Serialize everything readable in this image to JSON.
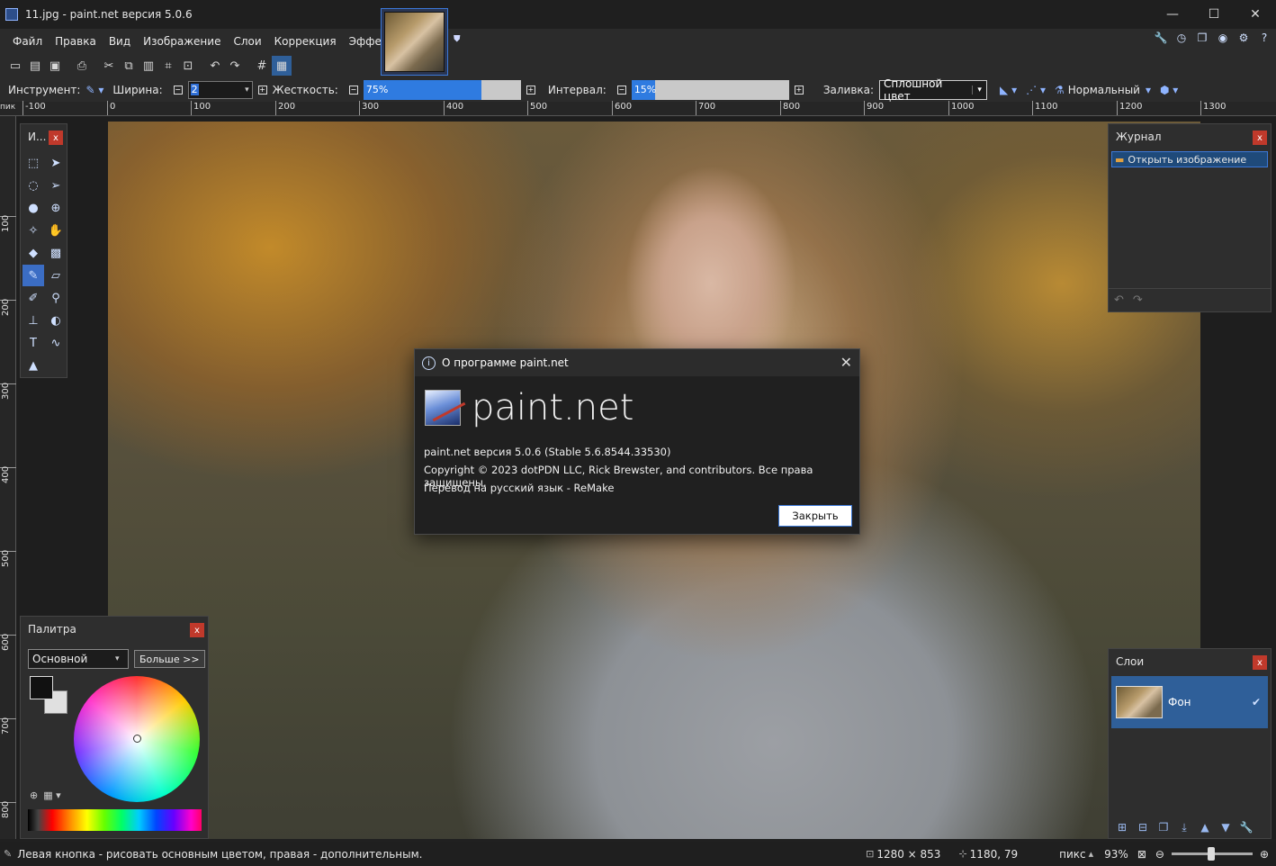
{
  "window": {
    "title": "11.jpg - paint.net версия 5.0.6",
    "controls": [
      "—",
      "☐",
      "✕"
    ]
  },
  "menu": {
    "items": [
      "Файл",
      "Правка",
      "Вид",
      "Изображение",
      "Слои",
      "Коррекция",
      "Эффекты"
    ]
  },
  "toolbar": {
    "icons": [
      "new-icon",
      "open-icon",
      "save-icon",
      "print-icon",
      "cut-icon",
      "copy-icon",
      "paste-icon",
      "crop-icon",
      "deselect-icon",
      "undo-icon",
      "redo-icon",
      "grid-icon",
      "ruler-icon"
    ]
  },
  "options": {
    "tool_label": "Инструмент:",
    "width_label": "Ширина:",
    "width_value": "2",
    "hardness_label": "Жесткость:",
    "hardness_value": "75%",
    "hardness_fraction": 0.75,
    "interval_label": "Интервал:",
    "interval_value": "15%",
    "interval_fraction": 0.15,
    "fill_label": "Заливка:",
    "fill_value": "Сплошной цвет",
    "blend_value": "Нормальный"
  },
  "ruler": {
    "unit": "пик",
    "top_labels": [
      "-100",
      "0",
      "100",
      "200",
      "300",
      "400",
      "500",
      "600",
      "700",
      "800",
      "900",
      "1000",
      "1100",
      "1200",
      "1300"
    ],
    "left_labels": [
      "100",
      "200",
      "300",
      "400",
      "500",
      "600",
      "700",
      "800"
    ]
  },
  "tools_panel": {
    "title": "И...",
    "close": "x"
  },
  "history_panel": {
    "title": "Журнал",
    "close": "x",
    "items": [
      "Открыть изображение"
    ]
  },
  "layers_panel": {
    "title": "Слои",
    "close": "x",
    "layers": [
      {
        "name": "Фон",
        "visible": true
      }
    ]
  },
  "palette_panel": {
    "title": "Палитра",
    "close": "x",
    "palette_select": "Основной",
    "more_button": "Больше >>"
  },
  "about_dialog": {
    "title": "О программе paint.net",
    "brand": "paint.net",
    "version_line": "paint.net версия 5.0.6 (Stable 5.6.8544.33530)",
    "copyright_line": "Copyright © 2023 dotPDN LLC, Rick Brewster, and contributors. Все права защищены.",
    "translation_line": "Перевод на русский язык - ReMake",
    "close_button": "Закрыть"
  },
  "status": {
    "hint": "Левая кнопка - рисовать основным цветом, правая - дополнительным.",
    "image_size": "1280 × 853",
    "cursor_pos": "1180, 79",
    "unit": "пикс",
    "zoom": "93%"
  },
  "colors": {
    "accent": "#3b78d8",
    "close_red": "#c0392b",
    "panel_bg": "#2e2e2e"
  }
}
